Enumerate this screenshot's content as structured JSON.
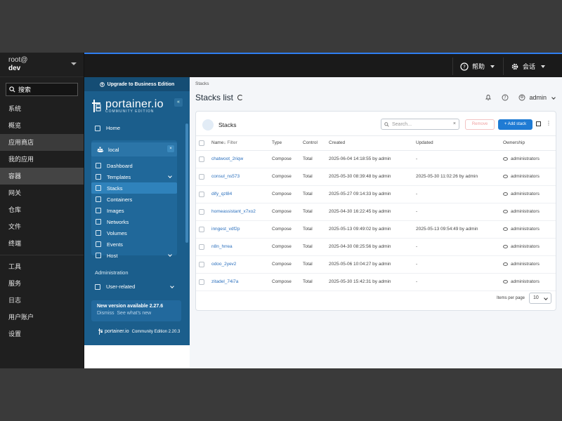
{
  "sys_sidebar": {
    "user_line1": "root@",
    "user_line2": "dev",
    "search_label": "搜索",
    "items": [
      {
        "label": "系统"
      },
      {
        "label": "概览"
      },
      {
        "label": "应用商店"
      },
      {
        "label": "我的应用"
      },
      {
        "label": "容器"
      },
      {
        "label": "网关"
      },
      {
        "label": "仓库"
      },
      {
        "label": "文件"
      },
      {
        "label": "终端"
      },
      {
        "label": "工具"
      },
      {
        "label": "服务"
      },
      {
        "label": "日志"
      },
      {
        "label": "用户账户"
      },
      {
        "label": "设置"
      }
    ]
  },
  "topbar": {
    "help_label": "帮助",
    "session_label": "会话"
  },
  "portainer": {
    "upgrade": "Upgrade to Business Edition",
    "logo_name": "portainer.io",
    "logo_edition": "COMMUNITY EDITION",
    "home": "Home",
    "env_name": "local",
    "nav": [
      {
        "label": "Dashboard"
      },
      {
        "label": "Templates"
      },
      {
        "label": "Stacks"
      },
      {
        "label": "Containers"
      },
      {
        "label": "Images"
      },
      {
        "label": "Networks"
      },
      {
        "label": "Volumes"
      },
      {
        "label": "Events"
      },
      {
        "label": "Host"
      }
    ],
    "administration": "Administration",
    "user_related": "User-related",
    "update_title": "New version available 2.27.6",
    "update_dismiss": "Dismiss",
    "update_link": "See what's new",
    "footer_logo": "portainer.io",
    "footer_text": "Community Edition 2.20.3"
  },
  "main": {
    "breadcrumb": "Stacks",
    "title": "Stacks list",
    "user": "admin",
    "card_title": "Stacks",
    "search_placeholder": "Search...",
    "remove_label": "Remove",
    "add_label": "+ Add stack",
    "columns": {
      "name": "Name↓",
      "filter": "Filter",
      "type": "Type",
      "control": "Control",
      "created": "Created",
      "updated": "Updated",
      "ownership": "Ownership"
    },
    "rows": [
      {
        "name": "chatwoot_2riqw",
        "type": "Compose",
        "control": "Total",
        "created": "2025-06-04 14:18:55 by admin",
        "updated": "-",
        "ownership": "administrators"
      },
      {
        "name": "consul_ns573",
        "type": "Compose",
        "control": "Total",
        "created": "2025-05-30 08:39:48 by admin",
        "updated": "2025-05-30 11:02:26 by admin",
        "ownership": "administrators"
      },
      {
        "name": "dify_qzl84",
        "type": "Compose",
        "control": "Total",
        "created": "2025-05-27 09:14:33 by admin",
        "updated": "-",
        "ownership": "administrators"
      },
      {
        "name": "homeassistant_x7xo2",
        "type": "Compose",
        "control": "Total",
        "created": "2025-04-30 16:22:45 by admin",
        "updated": "-",
        "ownership": "administrators"
      },
      {
        "name": "inngest_vdf2p",
        "type": "Compose",
        "control": "Total",
        "created": "2025-05-13 09:49:02 by admin",
        "updated": "2025-05-13 09:54:49 by admin",
        "ownership": "administrators"
      },
      {
        "name": "n8n_hrrea",
        "type": "Compose",
        "control": "Total",
        "created": "2025-04-30 08:25:56 by admin",
        "updated": "-",
        "ownership": "administrators"
      },
      {
        "name": "odoo_2yev2",
        "type": "Compose",
        "control": "Total",
        "created": "2025-05-06 10:04:27 by admin",
        "updated": "-",
        "ownership": "administrators"
      },
      {
        "name": "zitadel_74i7a",
        "type": "Compose",
        "control": "Total",
        "created": "2025-05-30 15:42:31 by admin",
        "updated": "-",
        "ownership": "administrators"
      }
    ],
    "items_per_page_label": "Items per page",
    "items_per_page_value": "10"
  }
}
